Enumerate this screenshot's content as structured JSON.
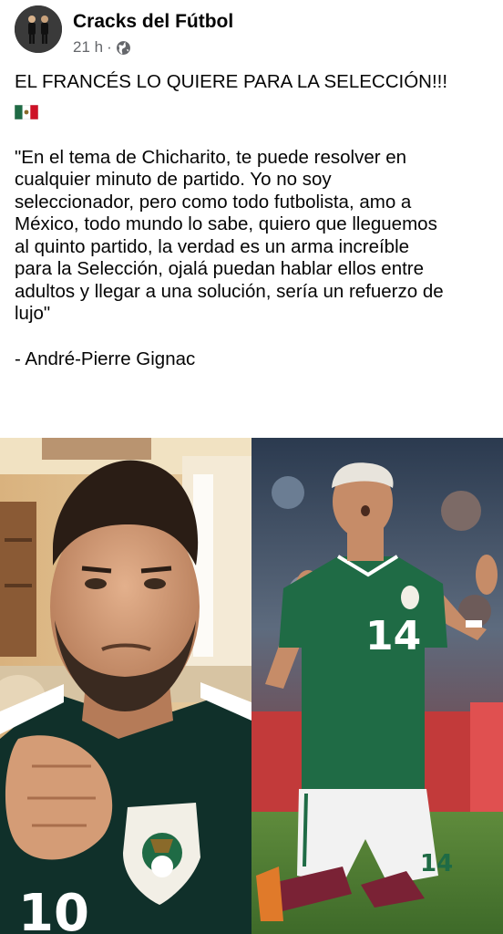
{
  "post": {
    "page_name": "Cracks del Fútbol",
    "time": "21 h",
    "separator": "·",
    "privacy_icon": "globe-icon",
    "avatar_icon": "page-avatar"
  },
  "content": {
    "headline": "EL FRANCÉS LO QUIERE PARA LA SELECCIÓN!!!",
    "flag_icon": "mexico-flag-emoji",
    "quote_lines": [
      "\"En el tema de Chicharito, te puede resolver en",
      "cualquier minuto de partido. Yo no soy",
      "seleccionador, pero como todo futbolista, amo a",
      "México, todo mundo lo sabe, quiero que lleguemos",
      "al quinto partido, la verdad es un arma increíble",
      "para la Selección, ojalá puedan hablar ellos entre",
      "adultos y llegar a una solución, sería un refuerzo de",
      "lujo\""
    ],
    "author": "- André-Pierre Gignac"
  },
  "photos": {
    "left_icon": "gignac-selfie-photo",
    "right_icon": "chicharito-kneeling-photo",
    "right_jersey_number": "14",
    "left_jersey_number": "10"
  },
  "colors": {
    "text": "#050505",
    "meta": "#65676b",
    "mexico_green": "#1f6b45",
    "mexico_red": "#ce1126"
  }
}
